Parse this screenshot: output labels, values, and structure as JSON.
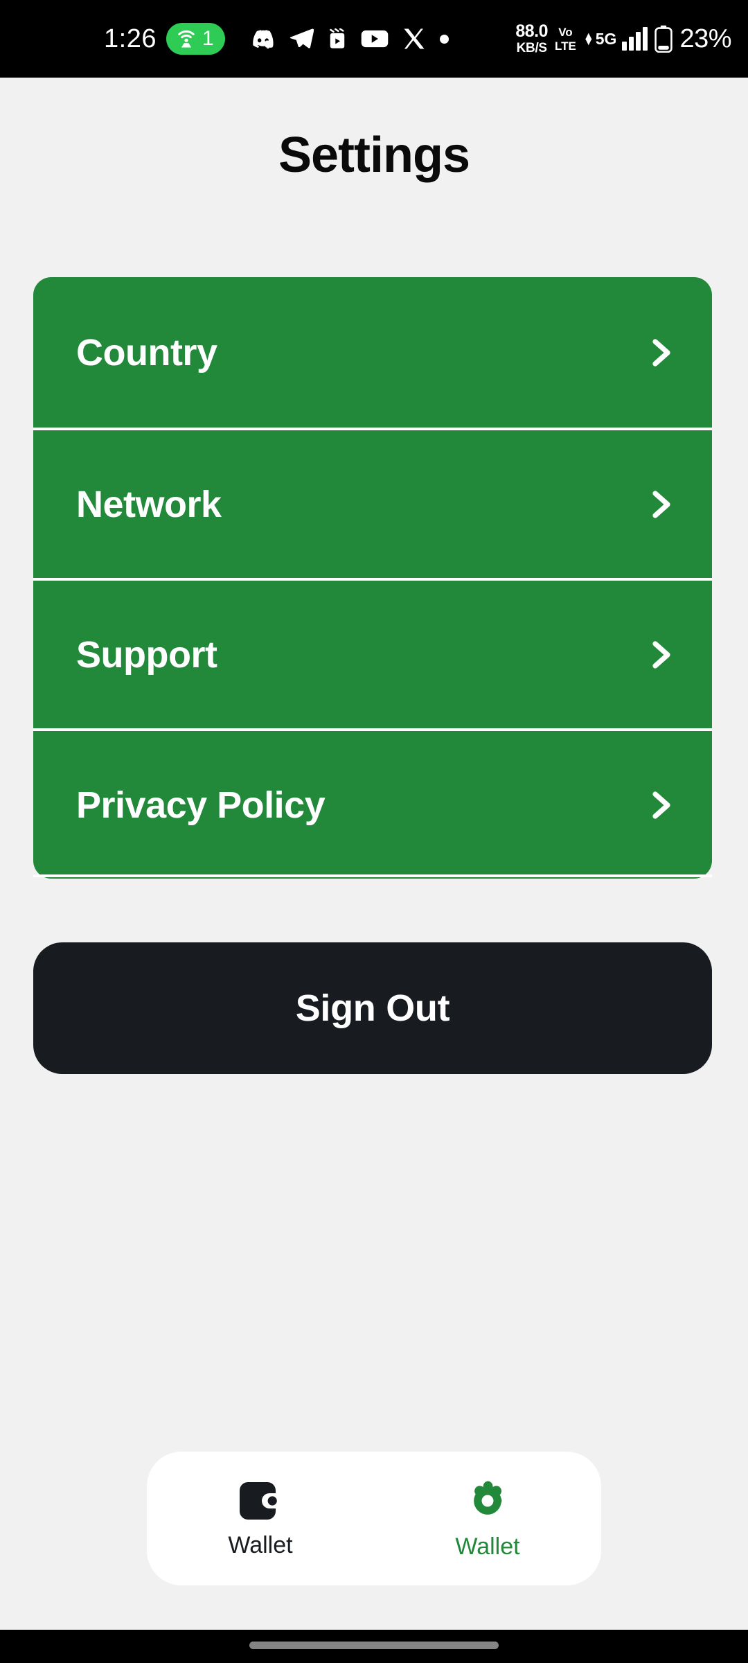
{
  "status_bar": {
    "clock": "1:26",
    "hotspot_count": "1",
    "app_icons": [
      "discord-icon",
      "telegram-icon",
      "clapperboard-icon",
      "youtube-icon",
      "x-twitter-icon",
      "dot-icon"
    ],
    "network_speed_value": "88.0",
    "network_speed_unit": "KB/S",
    "volte_line1": "Vo",
    "volte_line2": "LTE",
    "network_type": "5G",
    "battery_percent": "23%"
  },
  "header": {
    "title": "Settings"
  },
  "settings": {
    "accent_color": "#22883a",
    "rows": [
      {
        "label": "Country",
        "chevron": "chevron-right-icon"
      },
      {
        "label": "Network",
        "chevron": "chevron-right-icon"
      },
      {
        "label": "Support",
        "chevron": "chevron-right-icon"
      },
      {
        "label": "Privacy Policy",
        "chevron": "chevron-right-icon"
      }
    ]
  },
  "actions": {
    "sign_out_label": "Sign Out",
    "sign_out_bg": "#181c20"
  },
  "bottom_nav": {
    "items": [
      {
        "label": "Wallet",
        "icon": "wallet-icon",
        "active": false,
        "color": "#181c20"
      },
      {
        "label": "Wallet",
        "icon": "gear-icon",
        "active": true,
        "color": "#22883a"
      }
    ]
  }
}
